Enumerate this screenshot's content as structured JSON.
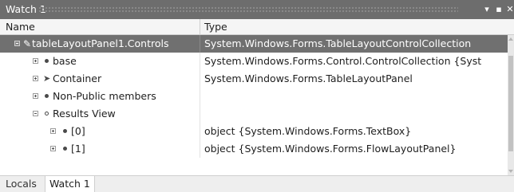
{
  "window": {
    "title": "Watch 1"
  },
  "title_controls": {
    "dropdown": "▾",
    "maximize": "▪",
    "close": "✕"
  },
  "columns": {
    "name": "Name",
    "type": "Type"
  },
  "rows": [
    {
      "name": "tableLayoutPanel1.Controls",
      "type": "System.Windows.Forms.TableLayoutControlCollection",
      "expander": "minus",
      "icon": "pencil"
    },
    {
      "name": "base",
      "type": "System.Windows.Forms.Control.ControlCollection {Syst",
      "expander": "plus",
      "icon": "dot"
    },
    {
      "name": "Container",
      "type": "System.Windows.Forms.TableLayoutPanel",
      "expander": "plus",
      "icon": "wrench"
    },
    {
      "name": "Non-Public members",
      "type": "",
      "expander": "plus",
      "icon": "dot"
    },
    {
      "name": "Results View",
      "type": "",
      "expander": "minus",
      "icon": "open-dot"
    },
    {
      "name": "[0]",
      "type": "object {System.Windows.Forms.TextBox}",
      "expander": "plus",
      "icon": "dot"
    },
    {
      "name": "[1]",
      "type": "object {System.Windows.Forms.FlowLayoutPanel}",
      "expander": "plus",
      "icon": "dot"
    }
  ],
  "tabs": [
    "Locals",
    "Watch 1"
  ],
  "icons": {
    "pencil": "✎",
    "wrench": "➤"
  }
}
